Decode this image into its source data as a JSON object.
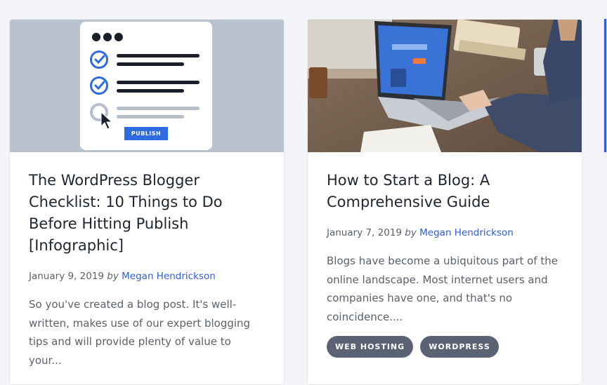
{
  "cards": [
    {
      "thumbnail": {
        "publish_label": "PUBLISH"
      },
      "title": "The WordPress Blogger Checklist: 10 Things to Do Before Hitting Publish [Infographic]",
      "date": "January 9, 2019",
      "by": "by",
      "author": "Megan Hendrickson",
      "excerpt": "So you've created a blog post. It's well-written, makes use of our expert blogging tips and will provide plenty of value to your..."
    },
    {
      "title": "How to Start a Blog: A Comprehensive Guide",
      "date": "January 7, 2019",
      "by": "by",
      "author": "Megan Hendrickson",
      "excerpt": "Blogs have become a ubiquitous part of the online landscape. Most internet users and companies have one, and that's no coincidence....",
      "tags": [
        "WEB HOSTING",
        "WORDPRESS"
      ]
    }
  ],
  "colors": {
    "accent": "#2f5ed8",
    "tag_bg": "#5a6273",
    "page_bg": "#f3f4f7"
  }
}
